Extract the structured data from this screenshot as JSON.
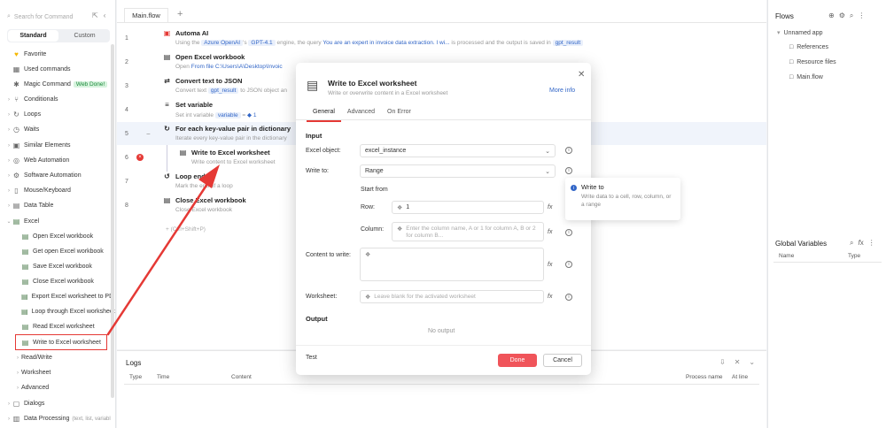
{
  "left": {
    "search_placeholder": "Search for Command",
    "tabs": [
      "Standard",
      "Custom"
    ],
    "items": [
      {
        "label": "Favorite",
        "icon": "heart-icon"
      },
      {
        "label": "Used commands",
        "icon": "history-icon"
      },
      {
        "label": "Magic Command",
        "icon": "magic-wand-icon",
        "badge": "Web Done!"
      },
      {
        "label": "Conditionals",
        "icon": "branch-icon"
      },
      {
        "label": "Loops",
        "icon": "loop-icon"
      },
      {
        "label": "Waits",
        "icon": "clock-icon"
      },
      {
        "label": "Similar Elements",
        "icon": "elements-icon"
      },
      {
        "label": "Web Automation",
        "icon": "globe-icon"
      },
      {
        "label": "Software Automation",
        "icon": "gear-icon"
      },
      {
        "label": "Mouse/Keyboard",
        "icon": "mouse-icon"
      },
      {
        "label": "Data Table",
        "icon": "table-icon"
      },
      {
        "label": "Excel",
        "icon": "excel-icon"
      },
      {
        "label": "Open Excel workbook",
        "icon": "excel-file-icon"
      },
      {
        "label": "Get open Excel workbook",
        "icon": "excel-file-icon"
      },
      {
        "label": "Save Excel workbook",
        "icon": "excel-file-icon"
      },
      {
        "label": "Close Excel workbook",
        "icon": "excel-file-icon"
      },
      {
        "label": "Export Excel worksheet to PD",
        "icon": "excel-file-icon"
      },
      {
        "label": "Loop through Excel worksheet",
        "icon": "excel-file-icon"
      },
      {
        "label": "Read Excel worksheet",
        "icon": "excel-file-icon"
      },
      {
        "label": "Write to Excel worksheet",
        "icon": "excel-file-icon"
      },
      {
        "label": "Read/Write",
        "icon": ""
      },
      {
        "label": "Worksheet",
        "icon": ""
      },
      {
        "label": "Advanced",
        "icon": ""
      },
      {
        "label": "Dialogs",
        "icon": "dialog-icon"
      },
      {
        "label": "Data Processing",
        "icon": "data-icon",
        "note": "(text, list, variabl"
      }
    ]
  },
  "center": {
    "file_tab": "Main.flow",
    "steps": [
      {
        "num": "1",
        "title": "Automa AI",
        "desc_pre": "Using the",
        "chip1": "Azure OpenAI",
        "desc_mid1": "'s",
        "chip2": "GPT-4.1",
        "desc_mid2": "engine, the query",
        "blue": "You are an expert in invoice data extraction. I wi...",
        "desc_mid3": "is processed and the output is saved in",
        "chip3": "gpt_result"
      },
      {
        "num": "2",
        "title": "Open Excel workbook",
        "desc_pre": "Open",
        "blue": "From file",
        "path": "C:\\Users\\A\\Desktop\\Invoic"
      },
      {
        "num": "3",
        "title": "Convert text to JSON",
        "desc_pre": "Convert text",
        "chip1": "gpt_result",
        "desc_mid1": "to JSON object an"
      },
      {
        "num": "4",
        "title": "Set variable",
        "desc_pre": "Set int variable",
        "chip1": "variable",
        "desc_mid1": "=",
        "value": "1"
      },
      {
        "num": "5",
        "title": "For each key-value pair in dictionary",
        "desc_pre": "Iterate every key-value pair in the dictionary"
      },
      {
        "num": "6",
        "title": "Write to Excel worksheet",
        "desc_pre": "Write content to Excel worksheet"
      },
      {
        "num": "7",
        "title": "Loop ends",
        "desc_pre": "Mark the end of a loop"
      },
      {
        "num": "8",
        "title": "Close Excel workbook",
        "desc_pre": "Close Excel workbook"
      }
    ],
    "add_hint": "+ (Ctrl+Shift+P)"
  },
  "logs": {
    "title": "Logs",
    "columns": [
      "Type",
      "Time",
      "Content",
      "Process name",
      "At line"
    ]
  },
  "right": {
    "flows_title": "Flows",
    "app": "Unnamed app",
    "items": [
      "References",
      "Resource files",
      "Main.flow"
    ],
    "gv_title": "Global Variables",
    "gv_columns": [
      "Name",
      "Type"
    ]
  },
  "modal": {
    "title": "Write to Excel worksheet",
    "subtitle": "Write or overwrite content in a Excel worksheet",
    "more_info": "More info",
    "tabs": [
      "General",
      "Advanced",
      "On Error"
    ],
    "input_label": "Input",
    "excel_object_label": "Excel object:",
    "excel_object_value": "excel_instance",
    "write_to_label": "Write to:",
    "write_to_value": "Range",
    "start_from": "Start from",
    "row_label": "Row:",
    "row_value": "1",
    "column_label": "Column:",
    "column_placeholder": "Enter the column name, A or 1 for column A, B or 2 for column B...",
    "content_label": "Content to write:",
    "worksheet_label": "Worksheet:",
    "worksheet_placeholder": "Leave blank for the activated worksheet",
    "output_label": "Output",
    "no_output": "No output",
    "test": "Test",
    "done": "Done",
    "cancel": "Cancel",
    "fx": "fx"
  },
  "tooltip": {
    "title": "Write to",
    "body": "Write data to a cell, row, column, or a range"
  },
  "colors": {
    "accent": "#e53935",
    "done_button": "#f0545a",
    "link_blue": "#3266c7",
    "badge_green": "#1c8a3a"
  }
}
